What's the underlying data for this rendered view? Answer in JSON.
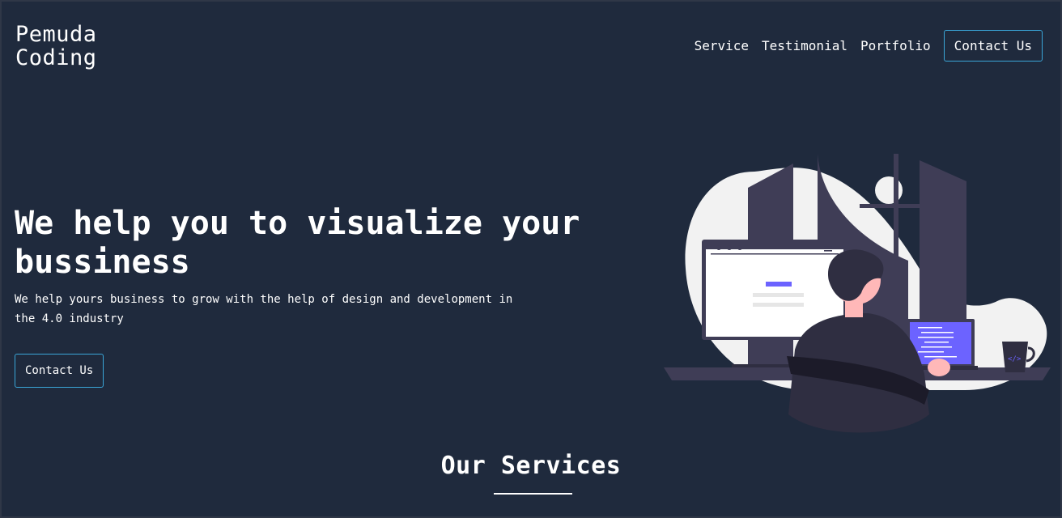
{
  "brand": {
    "line1": "Pemuda",
    "line2": "Coding"
  },
  "nav": {
    "items": [
      "Service",
      "Testimonial",
      "Portfolio"
    ],
    "contact_label": "Contact Us"
  },
  "hero": {
    "title": "We help you to visualize your bussiness",
    "subtitle": "We help yours business to grow with the help of design and development in the 4.0 industry",
    "button_label": "Contact Us",
    "illustration_icon": "developer-at-desk-illustration"
  },
  "services": {
    "title": "Our Services"
  },
  "colors": {
    "background": "#1f2a3d",
    "accent_border": "#3aa6d8",
    "illustration_accent": "#6c63ff"
  }
}
